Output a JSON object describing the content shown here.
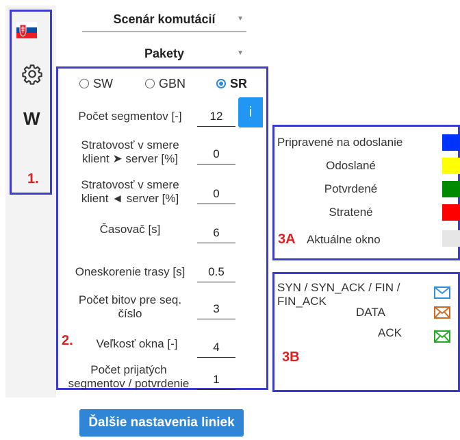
{
  "sidebar": {
    "flag_icon": "slovak-flag-icon",
    "settings_icon": "gear-icon",
    "w_label": "W",
    "marker": "1."
  },
  "selects": {
    "scenario": "Scenár komutácií",
    "type": "Pakety"
  },
  "protocols": [
    {
      "label": "SW",
      "selected": false
    },
    {
      "label": "GBN",
      "selected": false
    },
    {
      "label": "SR",
      "selected": true
    }
  ],
  "params": {
    "segments": {
      "label": "Počet segmentov [-]",
      "value": "12"
    },
    "loss_cs": {
      "label1": "Stratovosť v smere",
      "label2": "klient ➤ server [%]",
      "value": "0"
    },
    "loss_sc": {
      "label1": "Stratovosť v smere",
      "label2": "klient ◄ server [%]",
      "value": "0"
    },
    "timer": {
      "label": "Časovač [s]",
      "value": "6"
    },
    "delay": {
      "label": "Oneskorenie trasy [s]",
      "value": "0.5"
    },
    "seqbits": {
      "label1": "Počet bitov pre seq.",
      "label2": "číslo",
      "value": "3"
    },
    "window": {
      "label": "Veľkosť okna [-]",
      "value": "4"
    },
    "ack_per": {
      "label1": "Počet prijatých",
      "label2": "segmentov / potvrdenie",
      "value": "1"
    },
    "marker": "2."
  },
  "info_button": "i",
  "more_settings_button": "Ďalšie nastavenia liniek",
  "legend_states": {
    "marker": "3A",
    "items": [
      {
        "label": "Pripravené na odoslanie",
        "color": "#0033ff"
      },
      {
        "label": "Odoslané",
        "color": "#ffff00"
      },
      {
        "label": "Potvrdené",
        "color": "#008a00"
      },
      {
        "label": "Stratené",
        "color": "#ff0000"
      },
      {
        "label": "Aktuálne okno",
        "color": "#e6e6e6"
      }
    ]
  },
  "legend_packets": {
    "marker": "3B",
    "syn_label1": "SYN / SYN_ACK / FIN /",
    "syn_label2": "FIN_ACK",
    "data_label": "DATA",
    "ack_label": "ACK",
    "syn_color": "#2f8fe0",
    "data_color": "#d2691e",
    "ack_color": "#22aa22"
  }
}
